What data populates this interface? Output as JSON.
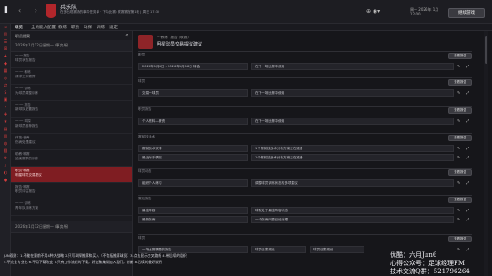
{
  "topbar": {
    "title": "兵乐队",
    "subtitle": "在多出现赛场的事件任务单 · 下场比赛: 联赛赛程第1轮 | 周日 17:30",
    "icons": "⊕ ◉▾",
    "date_line1": "周一 2026年 1月",
    "date_line2": "12:00",
    "continue_label": "继续游戏"
  },
  "tabs": [
    {
      "label": "概览"
    },
    {
      "label": "全员能力配置"
    },
    {
      "label": "教练"
    },
    {
      "label": "职员"
    },
    {
      "label": "球探"
    },
    {
      "label": "训练"
    },
    {
      "label": "设定"
    }
  ],
  "sidebar": {
    "header": "职员提案",
    "group1": "2026年1月12日星期一 (事务所)",
    "group2": "2026年1月12日星期一 (事务所)",
    "items": [
      {
        "line1": "一·一报告",
        "line2": "球员状态报告"
      },
      {
        "line1": "一·一 教练",
        "line2": "请求工作预算"
      },
      {
        "line1": "一·一 训练",
        "line2": "为球员调整训练"
      },
      {
        "line1": "一·一 报告",
        "line2": "新球队配置报告"
      },
      {
        "line1": "一·一 球探",
        "line2": "新球员推荐报告"
      },
      {
        "line1": "体能·营养",
        "line2": "伤病处理建议"
      },
      {
        "line1": "助教·联赛",
        "line2": "结束赛季的训练"
      },
      {
        "line1": "职员·联赛",
        "line2": "明星球员交易提议"
      },
      {
        "line1": "报告·联赛",
        "line2": "职员评估报告"
      },
      {
        "line1": "一·一 训练",
        "line2": "青年队训练方案"
      }
    ],
    "active_index": 7
  },
  "main": {
    "header_small": "一·教练 · 报告（联赛）",
    "header_title": "明星球员交易提议建议",
    "sections": [
      {
        "label": "职员",
        "left": "2026年1月4日 - 2026年1月18日 转会",
        "right": "在下一场比赛中使用",
        "pill": "查看报告"
      },
      {
        "label": "球员",
        "left": "交易一球员",
        "right": "在下一场比赛中使用",
        "pill": "查看报告"
      },
      {
        "label": "职员报告",
        "left": "个人资料—薪资",
        "right": "在下一场比赛中使用",
        "pill": "查看报告"
      },
      {
        "label": "赛前技战术",
        "left": "赛前战术安排",
        "right": "1个赛前技战术分析方案正在准备",
        "left2": "最近对手情况",
        "right2": "1个赛前技战术分析方案正在准备",
        "pill": "查看报告"
      },
      {
        "label": "球员动态",
        "left": "组织个人练习",
        "right": "调整球员训练状态的多项建议",
        "pill": "查看报告"
      },
      {
        "label": "赛后报告",
        "left": "最佳阵容",
        "right": "球队处于最佳阵容状态",
        "left2": "最新伤病",
        "right2": "一个伤病问题已经处理",
        "pill": "查看报告"
      },
      {
        "label": "球员",
        "left": "一场比赛需要的报告",
        "mid": "球员已表现优",
        "right": "球员已表现优",
        "pill": "查看报告"
      }
    ]
  },
  "caption": {
    "line1": "JUN观测：1.不能在赛前不用4种大战略 2.只写球探推荐和买入（不包括推荐球员）3.点击显示交叉路线 4.带后续的组织",
    "line2": "5.不完全专业化 6.不用下载改变 7.只有工作流程的下载，好友聚集请加入我们，谢谢 8.后续的最好说明",
    "right1": "优酷：六月Jun6",
    "right2": "心得公众号：足球经理FM",
    "right3": "技术交流Q群：521796264"
  }
}
